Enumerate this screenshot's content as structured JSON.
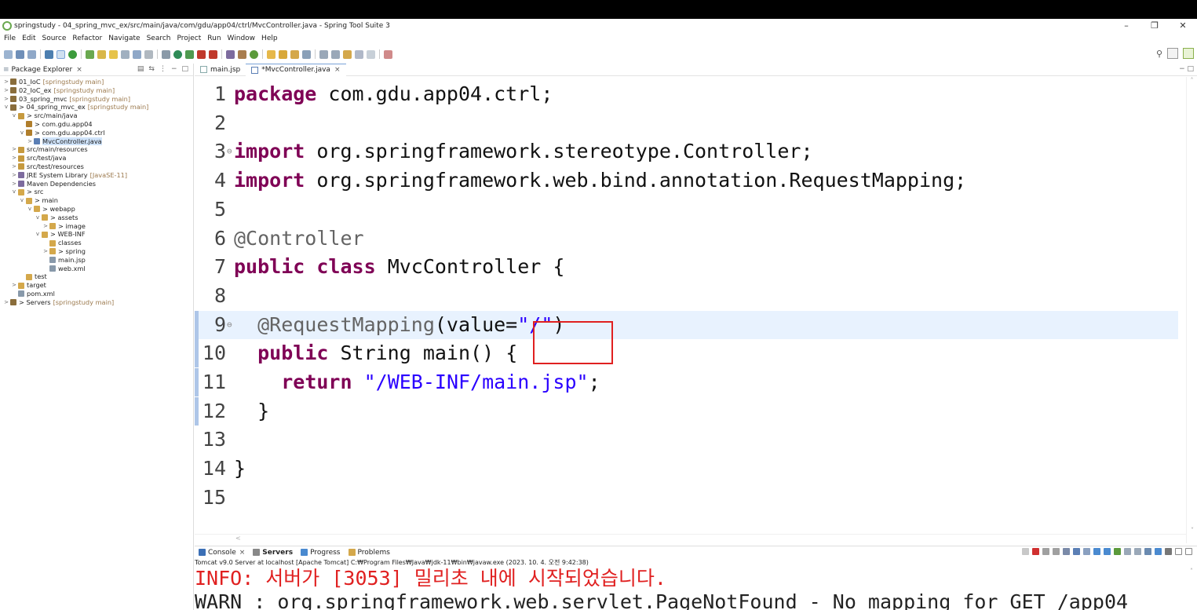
{
  "window": {
    "title": "springstudy - 04_spring_mvc_ex/src/main/java/com/gdu/app04/ctrl/MvcController.java - Spring Tool Suite 3",
    "minimize": "–",
    "restore": "❐",
    "close": "✕"
  },
  "menu": [
    "File",
    "Edit",
    "Source",
    "Refactor",
    "Navigate",
    "Search",
    "Project",
    "Run",
    "Window",
    "Help"
  ],
  "explorer": {
    "tab_label": "Package Explorer",
    "tree": [
      {
        "level": 0,
        "arrow": ">",
        "label": "01_IoC",
        "deco": "[springstudy main]",
        "color": "#8a6d3b"
      },
      {
        "level": 0,
        "arrow": ">",
        "label": "02_IoC_ex",
        "deco": "[springstudy main]",
        "color": "#8a6d3b"
      },
      {
        "level": 0,
        "arrow": ">",
        "label": "03_spring_mvc",
        "deco": "[springstudy main]",
        "color": "#8a6d3b"
      },
      {
        "level": 0,
        "arrow": "v",
        "label": "> 04_spring_mvc_ex",
        "deco": "[springstudy main]",
        "color": "#8a6d3b"
      },
      {
        "level": 1,
        "arrow": "v",
        "label": "> src/main/java",
        "deco": "",
        "color": "#c69a3f"
      },
      {
        "level": 2,
        "arrow": "",
        "label": "> com.gdu.app04",
        "deco": "",
        "color": "#b07e2c"
      },
      {
        "level": 2,
        "arrow": "v",
        "label": "> com.gdu.app04.ctrl",
        "deco": "",
        "color": "#b07e2c"
      },
      {
        "level": 3,
        "arrow": ">",
        "label": "MvcController.java",
        "deco": "",
        "color": "#5b7fb5",
        "selected": true
      },
      {
        "level": 1,
        "arrow": ">",
        "label": "src/main/resources",
        "deco": "",
        "color": "#c69a3f"
      },
      {
        "level": 1,
        "arrow": ">",
        "label": "src/test/java",
        "deco": "",
        "color": "#c69a3f"
      },
      {
        "level": 1,
        "arrow": ">",
        "label": "src/test/resources",
        "deco": "",
        "color": "#c69a3f"
      },
      {
        "level": 1,
        "arrow": ">",
        "label": "JRE System Library",
        "deco": "[JavaSE-11]",
        "color": "#7d6b9e"
      },
      {
        "level": 1,
        "arrow": ">",
        "label": "Maven Dependencies",
        "deco": "",
        "color": "#7d6b9e"
      },
      {
        "level": 1,
        "arrow": "v",
        "label": "> src",
        "deco": "",
        "color": "#d4a84b"
      },
      {
        "level": 2,
        "arrow": "v",
        "label": "> main",
        "deco": "",
        "color": "#d4a84b"
      },
      {
        "level": 3,
        "arrow": "v",
        "label": "> webapp",
        "deco": "",
        "color": "#d4a84b"
      },
      {
        "level": 4,
        "arrow": "v",
        "label": "> assets",
        "deco": "",
        "color": "#d4a84b"
      },
      {
        "level": 5,
        "arrow": ">",
        "label": "> image",
        "deco": "",
        "color": "#d4a84b"
      },
      {
        "level": 4,
        "arrow": "v",
        "label": "> WEB-INF",
        "deco": "",
        "color": "#d4a84b"
      },
      {
        "level": 5,
        "arrow": "",
        "label": "classes",
        "deco": "",
        "color": "#d4a84b"
      },
      {
        "level": 5,
        "arrow": ">",
        "label": "> spring",
        "deco": "",
        "color": "#d4a84b"
      },
      {
        "level": 5,
        "arrow": "",
        "label": "main.jsp",
        "deco": "",
        "color": "#8899aa"
      },
      {
        "level": 5,
        "arrow": "",
        "label": "web.xml",
        "deco": "",
        "color": "#8899aa"
      },
      {
        "level": 2,
        "arrow": "",
        "label": "test",
        "deco": "",
        "color": "#d4a84b"
      },
      {
        "level": 1,
        "arrow": ">",
        "label": "target",
        "deco": "",
        "color": "#d4a84b"
      },
      {
        "level": 1,
        "arrow": "",
        "label": "pom.xml",
        "deco": "",
        "color": "#8899aa"
      },
      {
        "level": 0,
        "arrow": ">",
        "label": "> Servers",
        "deco": "[springstudy main]",
        "color": "#8a6d3b"
      }
    ]
  },
  "editor": {
    "tabs": [
      {
        "label": "main.jsp",
        "active": false
      },
      {
        "label": "*MvcController.java",
        "active": true
      }
    ],
    "lines": [
      {
        "num": "1",
        "parts": [
          {
            "t": "package",
            "c": "kw"
          },
          {
            "t": " com.gdu.app04.ctrl;",
            "c": ""
          }
        ]
      },
      {
        "num": "2",
        "parts": []
      },
      {
        "num": "3",
        "fold": "⊖",
        "parts": [
          {
            "t": "import",
            "c": "kw"
          },
          {
            "t": " org.springframework.stereotype.Controller;",
            "c": ""
          }
        ]
      },
      {
        "num": "4",
        "parts": [
          {
            "t": "import",
            "c": "kw"
          },
          {
            "t": " org.springframework.web.bind.annotation.RequestMapping;",
            "c": ""
          }
        ]
      },
      {
        "num": "5",
        "parts": []
      },
      {
        "num": "6",
        "parts": [
          {
            "t": "@Controller",
            "c": "ann"
          }
        ]
      },
      {
        "num": "7",
        "parts": [
          {
            "t": "public",
            "c": "kw"
          },
          {
            "t": " ",
            "c": ""
          },
          {
            "t": "class",
            "c": "kw"
          },
          {
            "t": " MvcController {",
            "c": ""
          }
        ]
      },
      {
        "num": "8",
        "parts": []
      },
      {
        "num": "9",
        "fold": "⊖",
        "current": true,
        "marker": true,
        "parts": [
          {
            "t": "  @RequestMapping",
            "c": "ann"
          },
          {
            "t": "(value=",
            "c": ""
          },
          {
            "t": "\"/\"",
            "c": "str"
          },
          {
            "t": ")",
            "c": ""
          }
        ]
      },
      {
        "num": "10",
        "marker": true,
        "parts": [
          {
            "t": "  ",
            "c": ""
          },
          {
            "t": "public",
            "c": "kw"
          },
          {
            "t": " String main() {",
            "c": ""
          }
        ]
      },
      {
        "num": "11",
        "marker": true,
        "parts": [
          {
            "t": "    ",
            "c": ""
          },
          {
            "t": "return",
            "c": "kw"
          },
          {
            "t": " ",
            "c": ""
          },
          {
            "t": "\"/WEB-INF/main.jsp\"",
            "c": "str"
          },
          {
            "t": ";",
            "c": ""
          }
        ]
      },
      {
        "num": "12",
        "marker": true,
        "parts": [
          {
            "t": "  }",
            "c": ""
          }
        ]
      },
      {
        "num": "13",
        "parts": []
      },
      {
        "num": "14",
        "parts": [
          {
            "t": "}",
            "c": ""
          }
        ]
      },
      {
        "num": "15",
        "parts": []
      }
    ]
  },
  "console": {
    "tabs": [
      {
        "label": "Console",
        "closable": true,
        "color": "#3b6fb6"
      },
      {
        "label": "Servers",
        "closable": false,
        "color": "#555555",
        "active": true
      },
      {
        "label": "Progress",
        "closable": false,
        "color": "#4a8ad0"
      },
      {
        "label": "Problems",
        "closable": false,
        "color": "#d4a84b"
      }
    ],
    "header": "Tomcat v9.0 Server at localhost [Apache Tomcat] C:₩Program Files₩Java₩jdk-11₩bin₩javaw.exe  (2023. 10. 4. 오전 9:42:38)",
    "line1": "INFO: 서버가 [3053] 밀리초 내에 시작되었습니다.",
    "line2": "WARN : org.springframework.web.servlet.PageNotFound - No mapping for GET /app04"
  },
  "colors": {
    "keyword": "#7f0055",
    "string": "#2a00ff",
    "annotation": "#646464",
    "current_line": "#e8f2fe",
    "highlight_box": "#e02020",
    "console_info": "#e02020"
  }
}
